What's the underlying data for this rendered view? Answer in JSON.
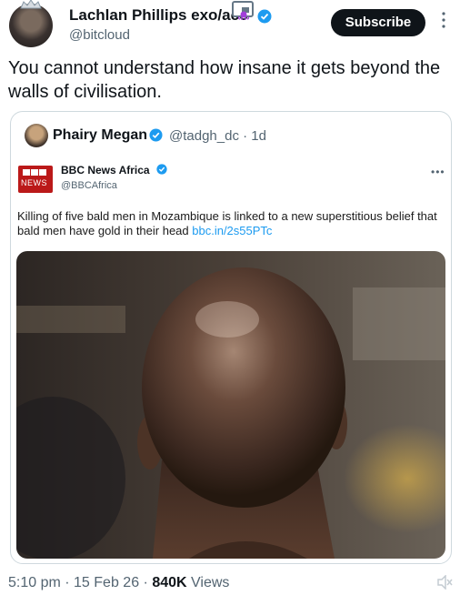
{
  "author": {
    "name": "Lachlan Phillips exo/acc",
    "handle": "@bitcloud",
    "subscribe_label": "Subscribe"
  },
  "tweet_text": "You cannot understand how insane it gets beyond the walls of civilisation.",
  "quoted": {
    "name": "Phairy Megan",
    "handle": "@tadgh_dc",
    "separator": "·",
    "time": "1d"
  },
  "embedded": {
    "logo_text": "NEWS",
    "name": "BBC News Africa",
    "handle": "@BBCAfrica",
    "text": "Killing of five bald men in Mozambique is linked to a new superstitious belief that bald men have gold in their head ",
    "link": "bbc.in/2s55PTc"
  },
  "footer": {
    "time": "5:10 pm",
    "separator": " · ",
    "date": "15 Feb 26",
    "views_count": "840K",
    "views_label": " Views"
  },
  "colors": {
    "verified": "#1d9bf0",
    "link": "#1d9bf0",
    "bbc_red": "#bb1919"
  },
  "icons": [
    "picture-in-picture-icon",
    "octopus-icon",
    "verified-badge-icon",
    "more-vertical-icon",
    "more-horizontal-icon",
    "mute-icon"
  ]
}
